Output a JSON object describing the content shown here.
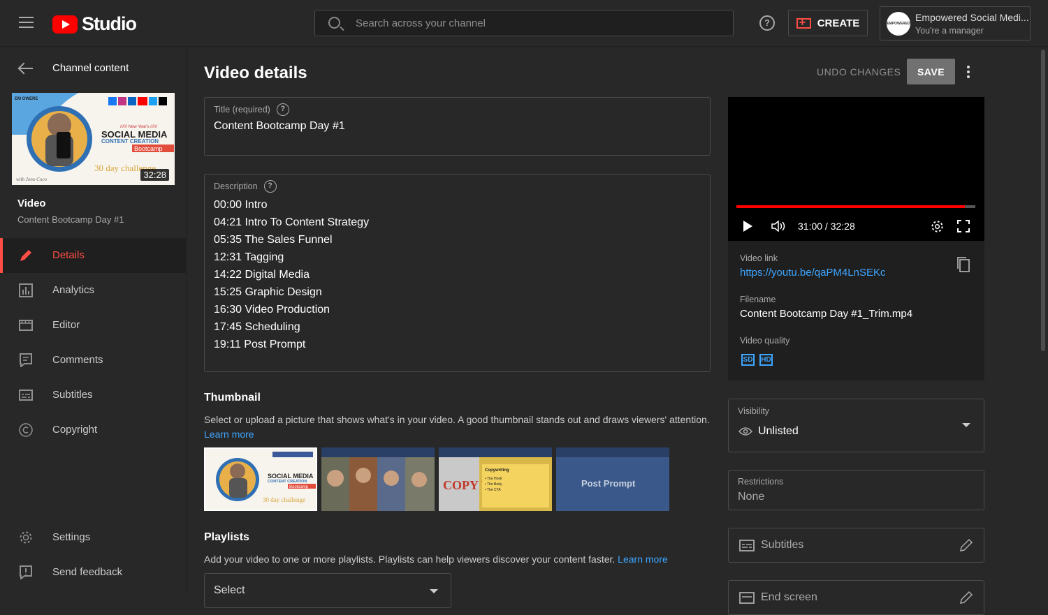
{
  "header": {
    "logo_text": "Studio",
    "search_placeholder": "Search across your channel",
    "create_label": "CREATE",
    "account_name": "Empowered Social Medi...",
    "account_role": "You're a manager",
    "avatar_text": "EMPOWERED"
  },
  "sidebar": {
    "back_label": "Channel content",
    "thumb_duration": "32:28",
    "video_heading": "Video",
    "video_title": "Content Bootcamp Day #1",
    "items": [
      {
        "label": "Details",
        "icon": "pencil-icon"
      },
      {
        "label": "Analytics",
        "icon": "analytics-icon"
      },
      {
        "label": "Editor",
        "icon": "editor-icon"
      },
      {
        "label": "Comments",
        "icon": "comments-icon"
      },
      {
        "label": "Subtitles",
        "icon": "subtitles-icon"
      },
      {
        "label": "Copyright",
        "icon": "copyright-icon"
      }
    ],
    "bottom_items": [
      {
        "label": "Settings",
        "icon": "gear-icon"
      },
      {
        "label": "Send feedback",
        "icon": "feedback-icon"
      }
    ]
  },
  "main": {
    "page_title": "Video details",
    "undo_label": "UNDO CHANGES",
    "save_label": "SAVE",
    "title_label": "Title (required)",
    "title_value": "Content Bootcamp Day #1",
    "description_label": "Description",
    "description_lines": [
      "00:00 Intro",
      "04:21 Intro To Content Strategy",
      "05:35 The Sales Funnel",
      "12:31 Tagging",
      "14:22 Digital Media",
      "15:25 Graphic Design",
      "16:30 Video Production",
      "17:45 Scheduling",
      "19:11 Post Prompt"
    ],
    "thumbnail_heading": "Thumbnail",
    "thumbnail_text": "Select or upload a picture that shows what's in your video. A good thumbnail stands out and draws viewers' attention.",
    "learn_more": "Learn more",
    "thumb_texts": {
      "social_media": "SOCIAL MEDIA",
      "content_creation": "CONTENT CREATION",
      "bootcamp": "Bootcamp",
      "challenge": "30 day challenge",
      "copy_writing": "COPY WRITING",
      "copywriting_title": "Copywriting",
      "hook": "• The Hook",
      "body": "• The Body",
      "cta": "• The CTA",
      "post_prompt": "Post Prompt",
      "new_years": "////// New Year's //////",
      "brand": "EM OWERE",
      "signature": "with Jono Coco"
    },
    "playlists_heading": "Playlists",
    "playlists_text": "Add your video to one or more playlists. Playlists can help viewers discover your content faster.",
    "playlist_select": "Select"
  },
  "player": {
    "time": "31:00 / 32:28",
    "progress": 0.955
  },
  "info": {
    "video_link_label": "Video link",
    "video_link": "https://youtu.be/qaPM4LnSEKc",
    "filename_label": "Filename",
    "filename": "Content Bootcamp Day #1_Trim.mp4",
    "quality_label": "Video quality",
    "quality_sd": "SD",
    "quality_hd": "HD"
  },
  "right": {
    "visibility_label": "Visibility",
    "visibility_value": "Unlisted",
    "restrictions_label": "Restrictions",
    "restrictions_value": "None",
    "subtitles_label": "Subtitles",
    "end_screen_label": "End screen"
  },
  "colors": {
    "accent_red": "#ff4e45",
    "link_blue": "#3ea6ff",
    "bg": "#282828",
    "card_bg": "#1f1f1f"
  }
}
